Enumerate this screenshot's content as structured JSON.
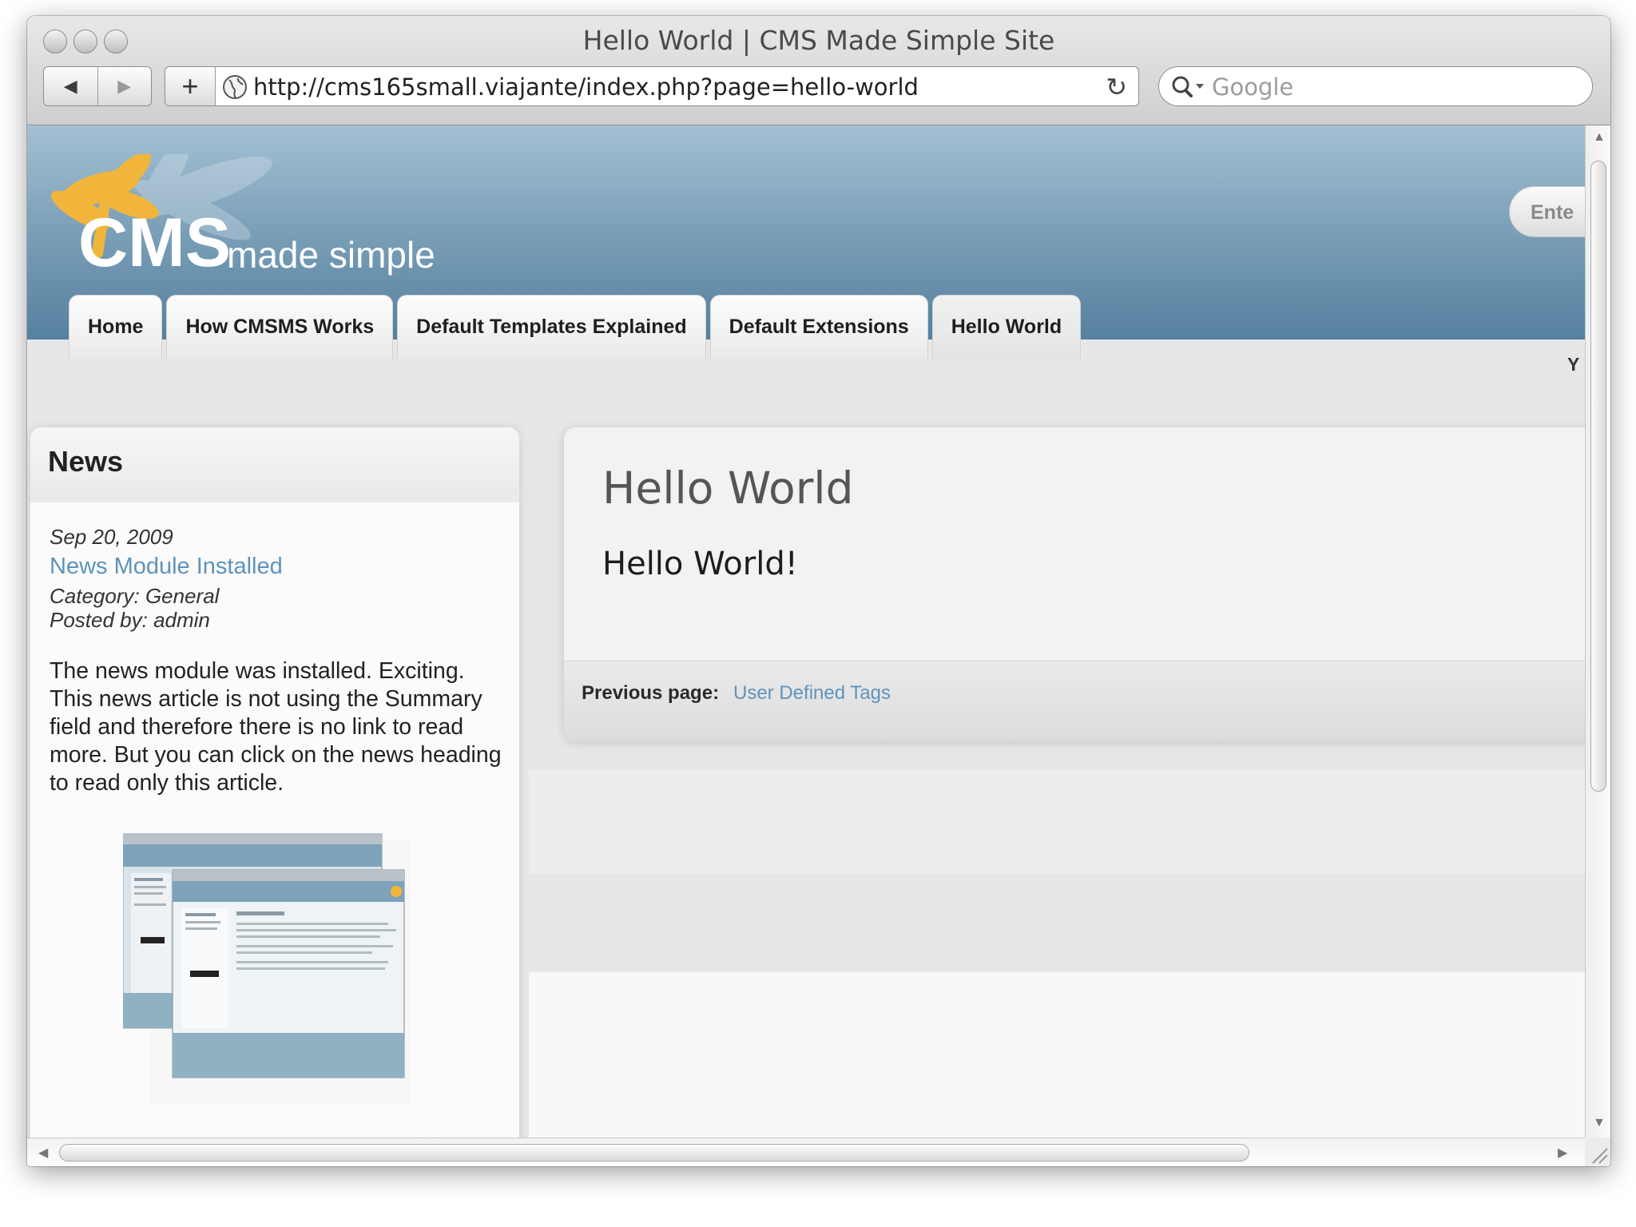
{
  "browser": {
    "window_title": "Hello World | CMS Made Simple Site",
    "back_label": "◀",
    "forward_label": "▶",
    "add_label": "+",
    "url": "http://cms165small.viajante/index.php?page=hello-world",
    "reload_label": "↻",
    "search_placeholder": "Google"
  },
  "site": {
    "logo_text": "CMS",
    "logo_tagline": "made simple",
    "header_search_value": "Ente",
    "nav_tabs": [
      {
        "label": "Home"
      },
      {
        "label": "How CMSMS Works"
      },
      {
        "label": "Default Templates Explained"
      },
      {
        "label": "Default Extensions"
      },
      {
        "label": "Hello World",
        "active": true
      }
    ],
    "clipped_text": "Y"
  },
  "sidebar": {
    "title": "News",
    "date": "Sep 20, 2009",
    "article_title": "News Module Installed",
    "category": "Category: General",
    "posted_by": "Posted by: admin",
    "body": "The news module was installed. Exciting. This news article is not using the Summary field and therefore there is no link to read more. But you can click on the news heading to read only this article."
  },
  "main": {
    "heading": "Hello World",
    "content": "Hello World!",
    "previous_label": "Previous page:",
    "previous_link": "User Defined Tags"
  },
  "colors": {
    "header_top": "#a4c0d4",
    "header_bottom": "#55809f",
    "link": "#5e93bc",
    "logo_orange": "#f0b53a"
  },
  "icons": {
    "globe": "globe-icon",
    "search": "magnifier-icon",
    "reload": "reload-icon"
  }
}
